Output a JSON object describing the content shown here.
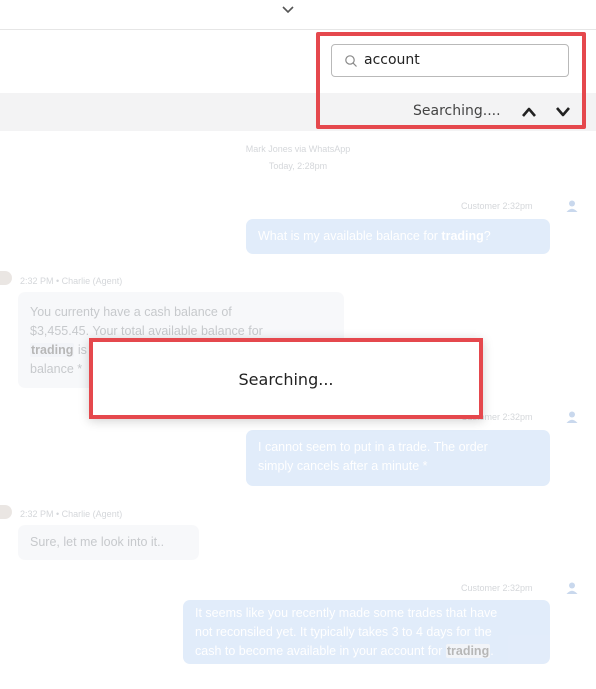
{
  "header": {
    "collapse_icon": "chevron-down-icon"
  },
  "search": {
    "value": "account",
    "status": "Searching....",
    "prev_icon": "chevron-up-icon",
    "next_icon": "chevron-down-icon"
  },
  "conversation": {
    "source": "Mark Jones via WhatsApp",
    "date": "Today, 2:28pm"
  },
  "messages": [
    {
      "sender": "Customer",
      "time": "2:32pm",
      "text_before": "What is my available balance for ",
      "highlight": "trading",
      "text_after": "?"
    },
    {
      "meta": "2:32 PM • Charlie (Agent)",
      "line1": "You currenty have a cash balance of",
      "line2": "$3,455.45. Your total available balance for",
      "line3_hl": "trading",
      "line3_rest": " is",
      "line4": "balance *"
    },
    {
      "sender": "Customer",
      "time": "2:32pm",
      "line1": "I cannot seem to put in a trade. The order",
      "line2": "simply cancels after a minute *"
    },
    {
      "meta": "2:32 PM • Charlie (Agent)",
      "text": "Sure, let me look into it.."
    },
    {
      "sender": "Customer",
      "time": "2:32pm",
      "line1": "It seems like you recently made some trades that have",
      "line2": "not reconsiled yet. It typically takes 3 to 4 days for the",
      "line3": "cash to become available in your account for ",
      "line3_hl": "trading",
      "line3_end": "."
    }
  ],
  "dialog": {
    "text": "Searching..."
  },
  "colors": {
    "highlight_border": "#e5484d",
    "customer_bubble": "#b9d2f4",
    "agent_bubble": "#eef0f4"
  }
}
